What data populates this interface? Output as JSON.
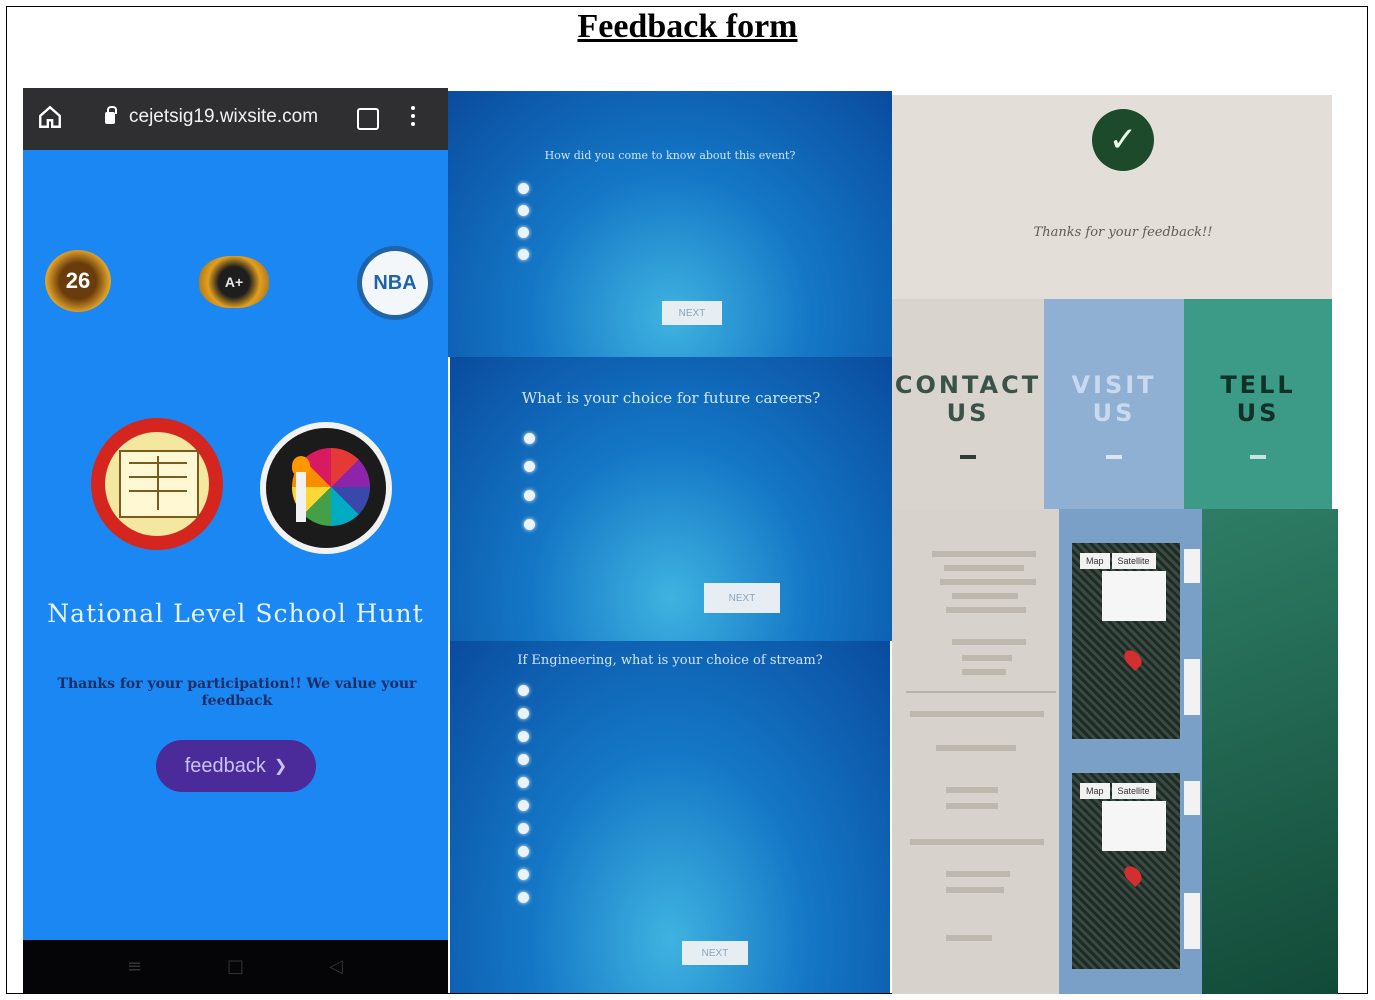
{
  "document": {
    "title": "Feedback form"
  },
  "phone": {
    "url": "cejetsig19.wixsite.com",
    "tabs_count": "",
    "badges": [
      "26",
      "A+",
      "NBA"
    ],
    "title": "National Level School Hunt",
    "subtitle": "Thanks for your participation!! We value your feedback",
    "button_label": "feedback",
    "button_chevron": "❯",
    "nav": [
      "≡",
      "□",
      "◁"
    ]
  },
  "survey1": {
    "question": "How did you come to know about this event?",
    "options": [
      "",
      "",
      "",
      ""
    ],
    "next_label": "NEXT"
  },
  "survey2": {
    "question": "What is your choice for future careers?",
    "options": [
      "",
      "",
      "",
      ""
    ],
    "next_label": "NEXT"
  },
  "survey3": {
    "question": "If Engineering, what is your choice of stream?",
    "options": [
      "",
      "",
      "",
      "",
      "",
      "",
      "",
      "",
      "",
      ""
    ],
    "next_label": "NEXT"
  },
  "thanks": {
    "check_glyph": "✓",
    "message": "Thanks for your feedback!!",
    "columns": [
      {
        "title_line1": "CONTACT",
        "title_line2": "US",
        "accent": "#2f3b36"
      },
      {
        "title_line1": "VISIT",
        "title_line2": "US",
        "accent": "#dbe7f5"
      },
      {
        "title_line1": "TELL",
        "title_line2": "US",
        "accent": "#c8e6de"
      }
    ]
  },
  "map_panel": {
    "tab_map": "Map",
    "tab_satellite": "Satellite"
  },
  "colors": {
    "phone_bg": "#1a87f2",
    "phone_button": "#4b2a9a",
    "survey_bg": "#1477c6",
    "check": "#1c4a2b"
  }
}
